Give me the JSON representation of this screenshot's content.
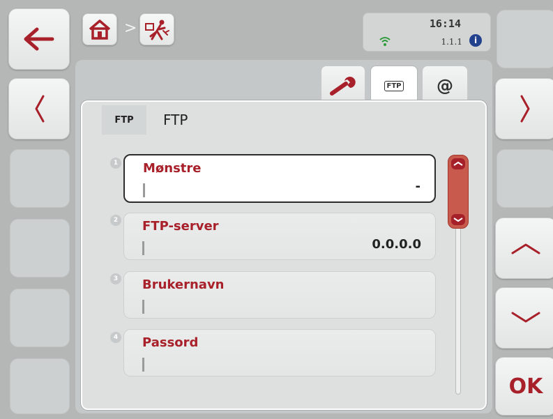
{
  "header": {
    "breadcrumb_separator": ">",
    "time": "16:14",
    "version": "1.1.1",
    "info_badge": "i"
  },
  "left_buttons": {
    "back_icon": "arrow-left-icon",
    "prev_icon": "chevron-left-icon"
  },
  "right_buttons": {
    "next_icon": "chevron-right-icon",
    "up_icon": "chevron-up-icon",
    "down_icon": "chevron-down-icon",
    "ok_label": "OK"
  },
  "tabs": [
    {
      "icon": "wrench-icon",
      "label": ""
    },
    {
      "icon": "ftp-icon",
      "label": "FTP"
    },
    {
      "icon": "at-icon",
      "label": "@"
    }
  ],
  "panel": {
    "icon_label": "FTP",
    "title": "FTP"
  },
  "fields": [
    {
      "num": "1",
      "label": "Mønstre",
      "value": "-"
    },
    {
      "num": "2",
      "label": "FTP-server",
      "value": "0.0.0.0"
    },
    {
      "num": "3",
      "label": "Brukernavn",
      "value": ""
    },
    {
      "num": "4",
      "label": "Passord",
      "value": ""
    }
  ],
  "colors": {
    "accent": "#a8202a",
    "scroll_thumb": "#c75a4d",
    "info_badge": "#22428e",
    "wifi": "#2f9a3a"
  }
}
